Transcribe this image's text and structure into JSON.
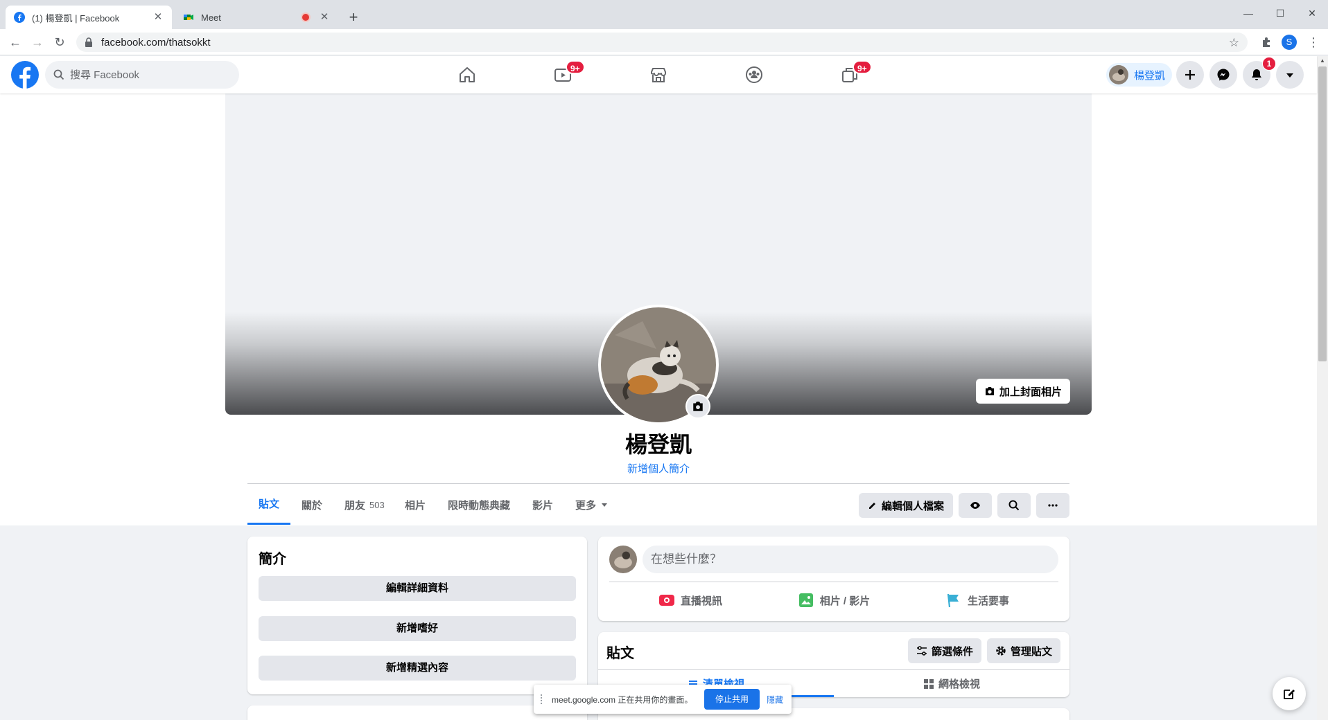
{
  "browser": {
    "tabs": [
      {
        "label": "(1) 楊登凱 | Facebook",
        "active": true,
        "icon": "facebook-favicon"
      },
      {
        "label": "Meet",
        "active": false,
        "icon": "google-meet-favicon",
        "recording": true
      }
    ],
    "url": "facebook.com/thatsokkt",
    "profile_initial": "S"
  },
  "fb_header": {
    "search_placeholder": "搜尋 Facebook",
    "nav": [
      {
        "name": "home-icon",
        "badge": ""
      },
      {
        "name": "watch-icon",
        "badge": "9+"
      },
      {
        "name": "marketplace-icon",
        "badge": ""
      },
      {
        "name": "groups-icon",
        "badge": ""
      },
      {
        "name": "gaming-icon",
        "badge": "9+"
      }
    ],
    "me_name": "楊登凱",
    "notifications_badge": "1",
    "brand_color": "#1877f2"
  },
  "profile": {
    "name": "楊登凱",
    "add_bio": "新增個人簡介",
    "cover_button": "加上封面相片",
    "tabs": [
      {
        "label": "貼文",
        "count": "",
        "active": true
      },
      {
        "label": "關於",
        "count": ""
      },
      {
        "label": "朋友",
        "count": "503"
      },
      {
        "label": "相片",
        "count": ""
      },
      {
        "label": "限時動態典藏",
        "count": ""
      },
      {
        "label": "影片",
        "count": ""
      },
      {
        "label": "更多",
        "count": ""
      }
    ],
    "edit_profile": "編輯個人檔案"
  },
  "intro": {
    "title": "簡介",
    "buttons": [
      "編輯詳細資料",
      "新增嗜好",
      "新增精選內容"
    ]
  },
  "composer": {
    "placeholder": "在想些什麼？",
    "actions": [
      "直播視訊",
      "相片 / 影片",
      "生活要事"
    ]
  },
  "posts": {
    "title": "貼文",
    "filter": "篩選條件",
    "manage": "管理貼文",
    "views": [
      "清單檢視",
      "網格檢視"
    ]
  },
  "share_bar": {
    "text": "meet.google.com 正在共用你的畫面。",
    "stop": "停止共用",
    "hide": "隱藏"
  }
}
